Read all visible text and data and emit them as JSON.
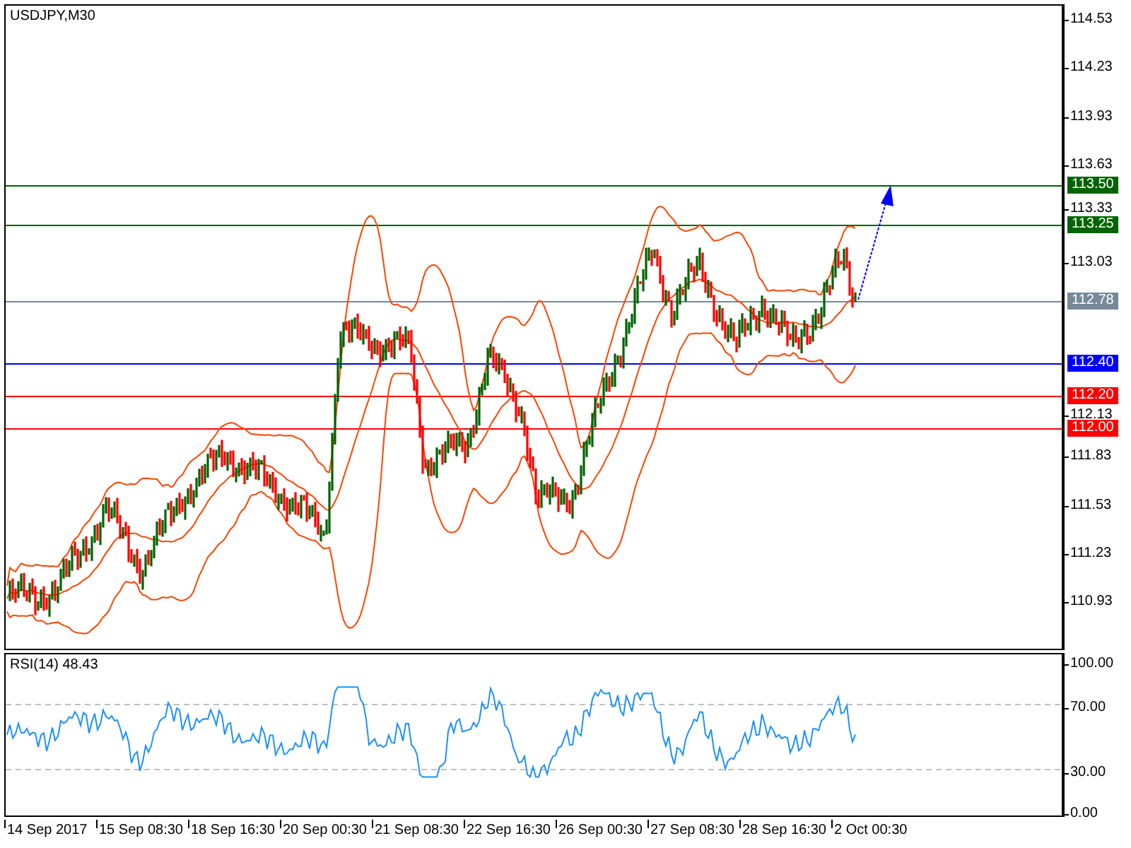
{
  "chart": {
    "title": "USDJPY,M30"
  },
  "price_axis": {
    "ticks": [
      "114.53",
      "114.23",
      "113.93",
      "113.63",
      "113.33",
      "113.03",
      "112.13",
      "111.83",
      "111.53",
      "111.23",
      "110.93"
    ]
  },
  "levels": [
    {
      "label": "113.50",
      "color": "#006400"
    },
    {
      "label": "113.25",
      "color": "#006400"
    },
    {
      "label": "112.78",
      "color": "#778899"
    },
    {
      "label": "112.40",
      "color": "#0000ff"
    },
    {
      "label": "112.20",
      "color": "#ff0000"
    },
    {
      "label": "112.00",
      "color": "#ff0000"
    }
  ],
  "rsi": {
    "label": "RSI(14) 48.43",
    "ticks": [
      "100.00",
      "70.00",
      "30.00",
      "0.00"
    ]
  },
  "time_axis": {
    "labels": [
      "14 Sep 2017",
      "15 Sep 08:30",
      "18 Sep 16:30",
      "20 Sep 00:30",
      "21 Sep 08:30",
      "22 Sep 16:30",
      "26 Sep 00:30",
      "27 Sep 08:30",
      "28 Sep 16:30",
      "2 Oct 00:30"
    ]
  }
}
